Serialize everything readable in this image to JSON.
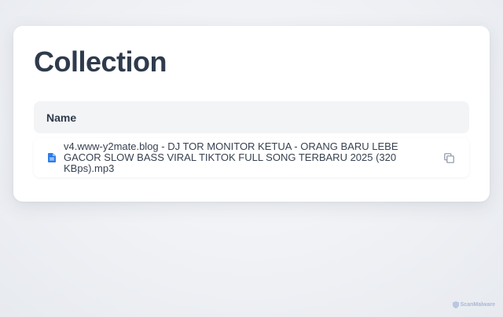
{
  "page": {
    "title": "Collection"
  },
  "table": {
    "columns": [
      {
        "label": "Name"
      }
    ],
    "rows": [
      {
        "name": "v4.www-y2mate.blog - DJ TOR MONITOR KETUA - ORANG BARU LEBE GACOR SLOW BASS VIRAL TIKTOK FULL SONG TERBARU 2025 (320 KBps).mp3",
        "icon": "file-document-icon"
      }
    ]
  },
  "watermark": {
    "label": "ScanMalware"
  },
  "colors": {
    "accent": "#2f7ee8",
    "title": "#2f3b4c",
    "header_bg": "#f3f4f6",
    "watermark": "#a9b8d6"
  }
}
